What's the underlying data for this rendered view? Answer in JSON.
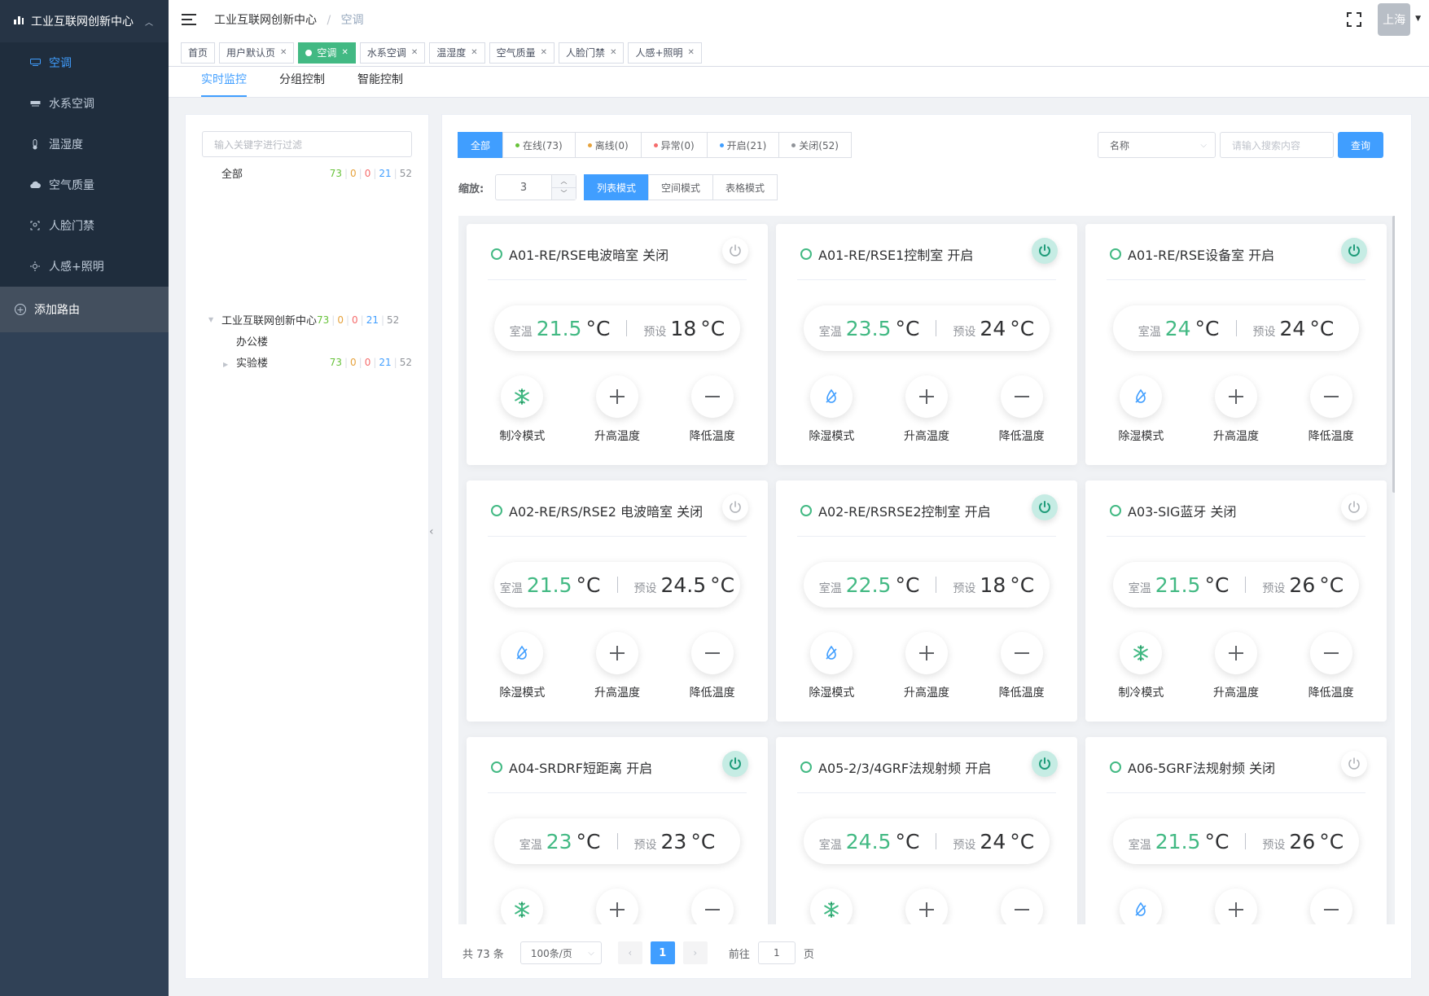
{
  "sidebar": {
    "header": "工业互联网创新中心",
    "items": [
      {
        "label": "空调",
        "icon": "ac-icon",
        "active": true
      },
      {
        "label": "水系空调",
        "icon": "water-ac-icon",
        "active": false
      },
      {
        "label": "温湿度",
        "icon": "thermometer-icon",
        "active": false
      },
      {
        "label": "空气质量",
        "icon": "cloud-icon",
        "active": false
      },
      {
        "label": "人脸门禁",
        "icon": "face-access-icon",
        "active": false
      },
      {
        "label": "人感+照明",
        "icon": "light-sensor-icon",
        "active": false
      }
    ],
    "add_route": "添加路由"
  },
  "navbar": {
    "breadcrumb": [
      "工业互联网创新中心",
      "空调"
    ],
    "user": "上海"
  },
  "tags": [
    {
      "label": "首页",
      "closable": false,
      "active": false
    },
    {
      "label": "用户默认页",
      "closable": true,
      "active": false
    },
    {
      "label": "空调",
      "closable": true,
      "active": true
    },
    {
      "label": "水系空调",
      "closable": true,
      "active": false
    },
    {
      "label": "温湿度",
      "closable": true,
      "active": false
    },
    {
      "label": "空气质量",
      "closable": true,
      "active": false
    },
    {
      "label": "人脸门禁",
      "closable": true,
      "active": false
    },
    {
      "label": "人感+照明",
      "closable": true,
      "active": false
    }
  ],
  "subtabs": [
    {
      "label": "实时监控",
      "active": true
    },
    {
      "label": "分组控制",
      "active": false
    },
    {
      "label": "智能控制",
      "active": false
    }
  ],
  "tree": {
    "filter_placeholder": "输入关键字进行过滤",
    "all_label": "全部",
    "all_counts": [
      "73",
      "0",
      "0",
      "21",
      "52"
    ],
    "root_label": "工业互联网创新中心",
    "root_counts": [
      "73",
      "0",
      "0",
      "21",
      "52"
    ],
    "child1": "办公楼",
    "child2": "实验楼",
    "child2_counts": [
      "73",
      "0",
      "0",
      "21",
      "52"
    ]
  },
  "status_filters": [
    {
      "label": "全部",
      "active": true,
      "dot": ""
    },
    {
      "label": "在线(73)",
      "active": false,
      "dot": "#67c23a"
    },
    {
      "label": "离线(0)",
      "active": false,
      "dot": "#e6a23c"
    },
    {
      "label": "异常(0)",
      "active": false,
      "dot": "#f56c6c"
    },
    {
      "label": "开启(21)",
      "active": false,
      "dot": "#409eff"
    },
    {
      "label": "关闭(52)",
      "active": false,
      "dot": "#909399"
    }
  ],
  "search": {
    "field_select": "名称",
    "placeholder": "请输入搜索内容",
    "query_button": "查询"
  },
  "zoom": {
    "label": "缩放:",
    "value": "3"
  },
  "view_modes": [
    {
      "label": "列表模式",
      "active": true
    },
    {
      "label": "空间模式",
      "active": false
    },
    {
      "label": "表格模式",
      "active": false
    }
  ],
  "labels": {
    "room": "室温",
    "preset": "预设",
    "unit": "°C",
    "raise": "升高温度",
    "lower": "降低温度"
  },
  "devices": [
    {
      "name": "A01-RE/RSE电波暗室 关闭",
      "on": false,
      "room": "21.5",
      "preset": "18",
      "mode": "制冷模式",
      "mode_icon": "snowflake-icon"
    },
    {
      "name": "A01-RE/RSE1控制室 开启",
      "on": true,
      "room": "23.5",
      "preset": "24",
      "mode": "除湿模式",
      "mode_icon": "droplet-icon"
    },
    {
      "name": "A01-RE/RSE设备室 开启",
      "on": true,
      "room": "24",
      "preset": "24",
      "mode": "除湿模式",
      "mode_icon": "droplet-icon"
    },
    {
      "name": "A02-RE/RS/RSE2 电波暗室 关闭",
      "on": false,
      "room": "21.5",
      "preset": "24.5",
      "mode": "除湿模式",
      "mode_icon": "droplet-icon"
    },
    {
      "name": "A02-RE/RSRSE2控制室 开启",
      "on": true,
      "room": "22.5",
      "preset": "18",
      "mode": "除湿模式",
      "mode_icon": "droplet-icon"
    },
    {
      "name": "A03-SIG蓝牙 关闭",
      "on": false,
      "room": "21.5",
      "preset": "26",
      "mode": "制冷模式",
      "mode_icon": "snowflake-icon"
    },
    {
      "name": "A04-SRDRF短距离 开启",
      "on": true,
      "room": "23",
      "preset": "23",
      "mode": "制冷模式",
      "mode_icon": "snowflake-icon"
    },
    {
      "name": "A05-2/3/4GRF法规射频 开启",
      "on": true,
      "room": "24.5",
      "preset": "24",
      "mode": "制冷模式",
      "mode_icon": "snowflake-icon"
    },
    {
      "name": "A06-5GRF法规射频 关闭",
      "on": false,
      "room": "21.5",
      "preset": "26",
      "mode": "除湿模式",
      "mode_icon": "droplet-icon"
    }
  ],
  "pagination": {
    "total": "共 73 条",
    "page_size": "100条/页",
    "current": "1",
    "goto_label": "前往",
    "goto_value": "1",
    "goto_suffix": "页"
  },
  "colors": {
    "accent": "#409eff",
    "success": "#42b983",
    "sidebar": "#304156"
  }
}
